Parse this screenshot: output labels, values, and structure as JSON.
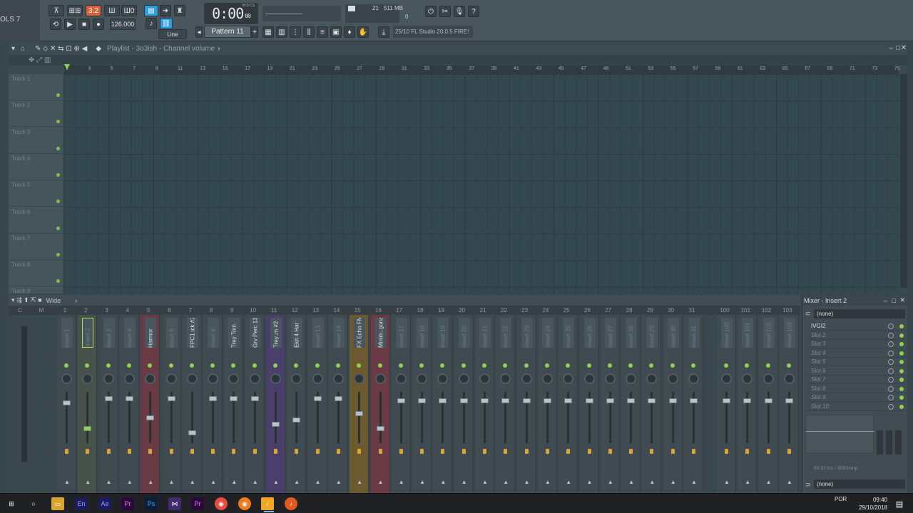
{
  "toolbar": {
    "hint_left": "OLS 7",
    "mode_buttons": [
      "⊼",
      "⊞⊞",
      "3.2",
      "Ш",
      "Ш0"
    ],
    "tempo": "126.000",
    "clock": "0:00",
    "clock_sub": "00",
    "clock_unit": "M:S:CS",
    "snap": "Line",
    "cpu": "21",
    "memory": "511 MB",
    "poly": "0",
    "pattern": "Pattern 11",
    "hint_text": "25/10  FL Studio 20.0.5 FIRE!",
    "help_icon": "?"
  },
  "playlist": {
    "title": "Playlist - 3o3ish - Channel volume",
    "ruler": [
      "1",
      "3",
      "5",
      "7",
      "9",
      "11",
      "13",
      "15",
      "17",
      "19",
      "21",
      "23",
      "25",
      "27",
      "29",
      "31",
      "33",
      "35",
      "37",
      "39",
      "41",
      "43",
      "45",
      "47",
      "49",
      "51",
      "53",
      "55",
      "57",
      "59",
      "61",
      "63",
      "65",
      "67",
      "69",
      "71",
      "73",
      "75"
    ],
    "tracks": [
      "Track 1",
      "Track 2",
      "Track 3",
      "Track 4",
      "Track 5",
      "Track 6",
      "Track 7",
      "Track 8",
      "Track 9"
    ]
  },
  "mixer": {
    "view": "Wide",
    "master_labels": [
      "C",
      "M"
    ],
    "title": "Mixer - Insert 2",
    "strips": [
      {
        "num": "1",
        "name": "Insert 1",
        "named": false
      },
      {
        "num": "2",
        "name": "Insert 2",
        "named": false
      },
      {
        "num": "3",
        "name": "Insert 3",
        "named": false
      },
      {
        "num": "4",
        "name": "Insert 4",
        "named": false
      },
      {
        "num": "5",
        "name": "Harmor",
        "named": true
      },
      {
        "num": "6",
        "name": "Insert 6",
        "named": false
      },
      {
        "num": "7",
        "name": "FPC1 ick #2",
        "named": true
      },
      {
        "num": "8",
        "name": "Insert 8",
        "named": false
      },
      {
        "num": "9",
        "name": "Trey Tom",
        "named": true
      },
      {
        "num": "10",
        "name": "Grv Perc 13",
        "named": true
      },
      {
        "num": "11",
        "name": "Trey..m #2",
        "named": true
      },
      {
        "num": "12",
        "name": "Ekit 4 Hat",
        "named": true
      },
      {
        "num": "13",
        "name": "Insert 13",
        "named": false
      },
      {
        "num": "14",
        "name": "Insert 14",
        "named": false
      },
      {
        "num": "15",
        "name": "FX Echo FM",
        "named": true
      },
      {
        "num": "16",
        "name": "Minim..gonal",
        "named": true
      },
      {
        "num": "17",
        "name": "Insert 17",
        "named": false
      },
      {
        "num": "18",
        "name": "Insert 18",
        "named": false
      },
      {
        "num": "19",
        "name": "Insert 19",
        "named": false
      },
      {
        "num": "20",
        "name": "Insert 20",
        "named": false
      },
      {
        "num": "21",
        "name": "Insert 21",
        "named": false
      },
      {
        "num": "22",
        "name": "Insert 22",
        "named": false
      },
      {
        "num": "23",
        "name": "Insert 23",
        "named": false
      },
      {
        "num": "24",
        "name": "Insert 24",
        "named": false
      },
      {
        "num": "25",
        "name": "Insert 25",
        "named": false
      },
      {
        "num": "26",
        "name": "Insert 26",
        "named": false
      },
      {
        "num": "27",
        "name": "Insert 27",
        "named": false
      },
      {
        "num": "28",
        "name": "Insert 28",
        "named": false
      },
      {
        "num": "29",
        "name": "Insert 29",
        "named": false
      },
      {
        "num": "30",
        "name": "Insert 30",
        "named": false
      },
      {
        "num": "31",
        "name": "Insert 31",
        "named": false
      }
    ],
    "extra_strips": [
      {
        "num": "100",
        "name": "Insert 100"
      },
      {
        "num": "101",
        "name": "Insert 101"
      },
      {
        "num": "102",
        "name": "Insert 102"
      },
      {
        "num": "103",
        "name": "Insert 103"
      }
    ],
    "input": "(none)",
    "output": "(none)",
    "slots": [
      "IVGI2",
      "Slot 2",
      "Slot 3",
      "Slot 4",
      "Slot 5",
      "Slot 6",
      "Slot 7",
      "Slot 8",
      "Slot 9",
      "Slot 10"
    ],
    "latency": "69.91ms / 3083smp"
  },
  "colors": {
    "accent_orange": "#d8603c",
    "accent_blue": "#2f9fdc",
    "led_green": "#8fd14f",
    "highlight_red": "#8a4a50",
    "highlight_purple": "#5a4a7a",
    "highlight_yellow": "#7a6a3a"
  },
  "taskbar": {
    "apps": [
      "windows-start-icon",
      "search-icon",
      "file-explorer-icon",
      "en-icon",
      "ae-icon",
      "pr-icon",
      "ps-icon",
      "vs-icon",
      "premiere-icon",
      "chrome-icon",
      "firefox-icon",
      "fl-studio-icon",
      "fl-studio-2-icon"
    ],
    "lang": "POR",
    "time": "09:40",
    "date": "29/10/2018"
  }
}
